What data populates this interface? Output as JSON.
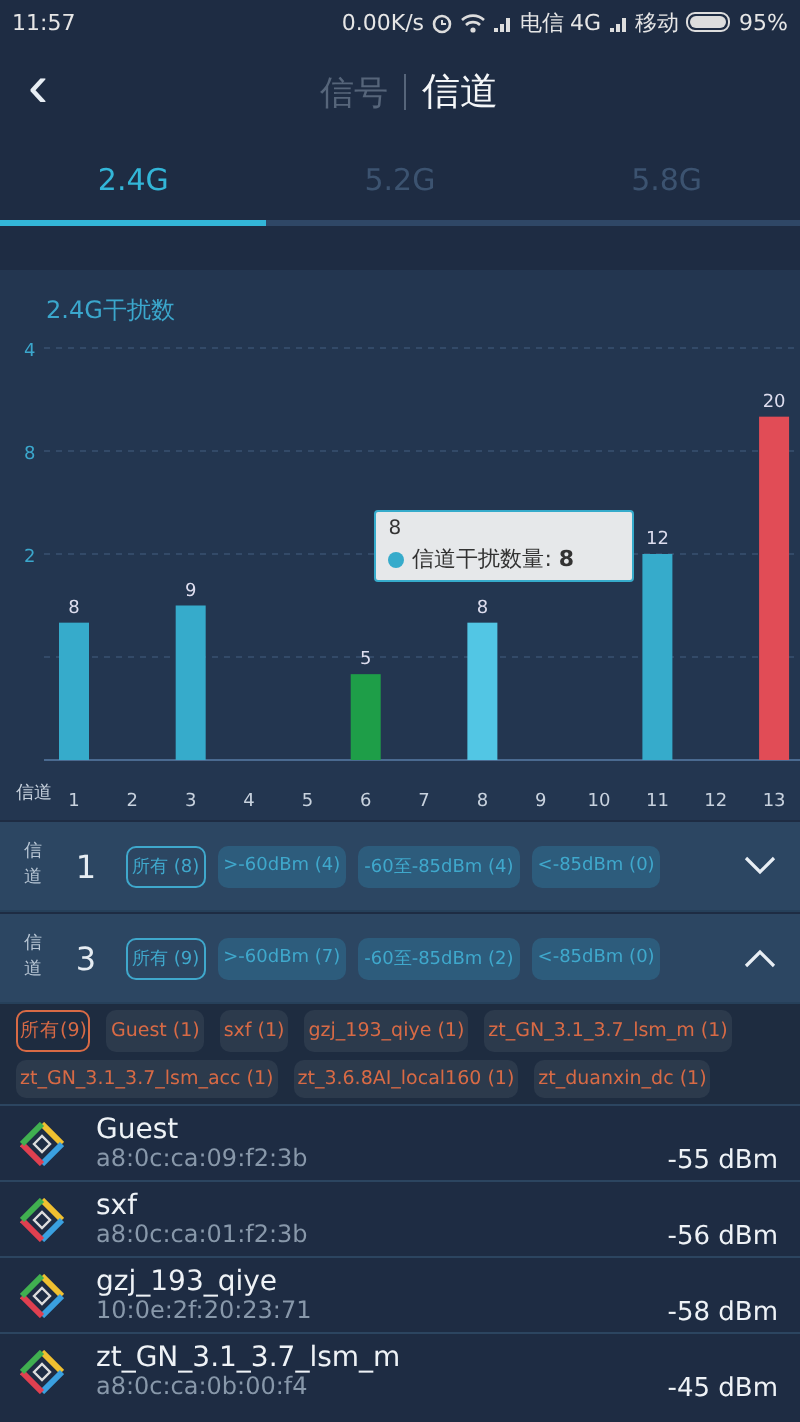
{
  "status_bar": {
    "time": "11:57",
    "speed": "0.00K/s",
    "carrier_1": "电信",
    "network_1": "4G",
    "carrier_2": "移动",
    "battery": "95%"
  },
  "header": {
    "back": "‹",
    "tabs": [
      {
        "label": "信号",
        "selected": false
      },
      {
        "label": "信道",
        "selected": true
      }
    ]
  },
  "band_tabs": [
    {
      "label": "2.4G",
      "selected": true
    },
    {
      "label": "5.2G",
      "selected": false
    },
    {
      "label": "5.8G",
      "selected": false
    }
  ],
  "chart": {
    "chart_data": {
      "type": "bar",
      "title": "2.4G干扰数",
      "xlabel": "信道",
      "categories": [
        "1",
        "2",
        "3",
        "4",
        "5",
        "6",
        "7",
        "8",
        "9",
        "10",
        "11",
        "12",
        "13"
      ],
      "series": [
        {
          "color": "#36abcb",
          "values": [
            8,
            null,
            9,
            null,
            null,
            null,
            null,
            null,
            null,
            null,
            12,
            null,
            null
          ]
        },
        {
          "name": "信道干扰数量",
          "color": "#52c6e4",
          "values": [
            null,
            null,
            null,
            null,
            null,
            null,
            null,
            8,
            null,
            null,
            null,
            null,
            null
          ]
        },
        {
          "color": "#1e9e48",
          "values": [
            null,
            null,
            null,
            null,
            null,
            5,
            null,
            null,
            null,
            null,
            null,
            null,
            null
          ]
        },
        {
          "color": "#e14c56",
          "values": [
            null,
            null,
            null,
            null,
            null,
            null,
            null,
            null,
            null,
            null,
            null,
            null,
            20
          ]
        }
      ],
      "ylim": [
        0,
        24
      ],
      "ref_lines": [
        {
          "axis": "y",
          "value": 6
        },
        {
          "axis": "y",
          "value": 12
        },
        {
          "axis": "y",
          "value": 18
        },
        {
          "axis": "y",
          "value": 24
        }
      ],
      "data_labels": true
    },
    "y_axis_labels": [
      "4",
      "8",
      "2"
    ],
    "tooltip": {
      "title": "8",
      "separator": ":"
    }
  },
  "channels": [
    {
      "label": "信道",
      "number": "1",
      "expanded": false,
      "filters": [
        {
          "label": "所有 (8)",
          "selected": true
        },
        {
          "label": ">-60dBm (4)",
          "selected": false
        },
        {
          "label": "-60至-85dBm (4)",
          "selected": false
        },
        {
          "label": "<-85dBm (0)",
          "selected": false
        }
      ]
    },
    {
      "label": "信道",
      "number": "3",
      "expanded": true,
      "filters": [
        {
          "label": "所有 (9)",
          "selected": true
        },
        {
          "label": ">-60dBm (7)",
          "selected": false
        },
        {
          "label": "-60至-85dBm (2)",
          "selected": false
        },
        {
          "label": "<-85dBm (0)",
          "selected": false
        }
      ]
    }
  ],
  "ssid_filters": [
    {
      "label": "所有(9)",
      "selected": true
    },
    {
      "label": "Guest (1)",
      "selected": false
    },
    {
      "label": "sxf (1)",
      "selected": false
    },
    {
      "label": "gzj_193_qiye (1)",
      "selected": false
    },
    {
      "label": "zt_GN_3.1_3.7_lsm_m (1)",
      "selected": false
    },
    {
      "label": "zt_GN_3.1_3.7_lsm_acc (1)",
      "selected": false
    },
    {
      "label": "zt_3.6.8AI_local160 (1)",
      "selected": false
    },
    {
      "label": "zt_duanxin_dc (1)",
      "selected": false
    }
  ],
  "networks": [
    {
      "name": "Guest",
      "mac": "a8:0c:ca:09:f2:3b",
      "signal": "-55 dBm"
    },
    {
      "name": "sxf",
      "mac": "a8:0c:ca:01:f2:3b",
      "signal": "-56 dBm"
    },
    {
      "name": "gzj_193_qiye",
      "mac": "10:0e:2f:20:23:71",
      "signal": "-58 dBm"
    },
    {
      "name": "zt_GN_3.1_3.7_lsm_m",
      "mac": "a8:0c:ca:0b:00:f4",
      "signal": "-45 dBm"
    }
  ]
}
